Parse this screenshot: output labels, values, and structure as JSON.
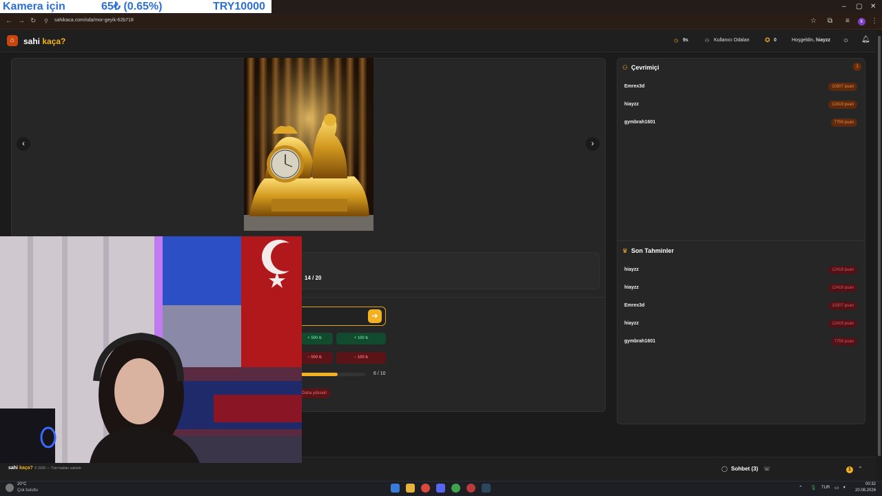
{
  "overlay": {
    "label": "Kamera için",
    "price": "65₺ (0.65%)",
    "code": "TRY10000"
  },
  "browser": {
    "url": "sahikaca.com/oda/mor-geyik-62b718",
    "profile_initial": "k"
  },
  "header": {
    "brand_main": "sahi ",
    "brand_accent": "kaça?",
    "timer": "9s",
    "rooms_label": "Kullanıcı Odaları",
    "score": "0",
    "greeting": "Hoşgeldin,",
    "username": "hiayzz"
  },
  "game": {
    "round": "14 / 20",
    "adjust_buttons": {
      "plus_500": "+ 500 ₺",
      "plus_100": "+ 100 ₺",
      "minus_500": "− 500 ₺",
      "minus_100": "− 100 ₺"
    },
    "attempts": "6 / 10",
    "attempts_fraction": 0.6,
    "feedback": "Daha yüksek!"
  },
  "online": {
    "title": "Çevrimiçi",
    "count": "3",
    "users": [
      {
        "name": "Emrex3d",
        "points": "10307 puan"
      },
      {
        "name": "hiayzz",
        "points": "12419 puan"
      },
      {
        "name": "gymbrah1601",
        "points": "7759 puan"
      }
    ]
  },
  "recent": {
    "title": "Son Tahminler",
    "guesses": [
      {
        "name": "hiayzz",
        "points": "12419 puan"
      },
      {
        "name": "hiayzz",
        "points": "12419 puan"
      },
      {
        "name": "Emrex3d",
        "points": "10307 puan"
      },
      {
        "name": "hiayzz",
        "points": "12419 puan"
      },
      {
        "name": "gymbrah1601",
        "points": "7759 puan"
      }
    ]
  },
  "footer": {
    "brand_main": "sahi ",
    "brand_accent": "kaça?",
    "copyright": "© 2026 — Tüm hakları saklıdır.",
    "chat_label": "Sohbet (3)",
    "notification_count": "1"
  },
  "taskbar": {
    "temperature": "20°C",
    "weather": "Çok bulutlu",
    "language": "TUR",
    "time": "00:32",
    "date": "20.08.2026"
  },
  "colors": {
    "accent": "#f3b020",
    "brand": "#c9470e",
    "plus": "#58c98a",
    "minus": "#e6676d"
  }
}
